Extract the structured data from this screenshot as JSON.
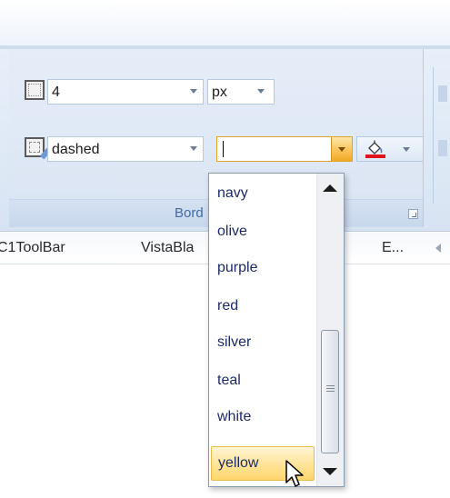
{
  "toolbar": {
    "border_width_value": "4",
    "border_unit_value": "px",
    "border_style_value": "dashed",
    "border_color_value": "",
    "group_caption": "Bord",
    "accent_color": "#f2a726",
    "fill_color_bar": "#e0141c"
  },
  "tabs": [
    "C1ToolBar",
    "VistaBla",
    "E..."
  ],
  "color_list": {
    "items": [
      "navy",
      "olive",
      "purple",
      "red",
      "silver",
      "teal",
      "white",
      "yellow"
    ],
    "highlighted": "yellow"
  },
  "icons": [
    "border-width-icon",
    "border-style-icon",
    "fill-color-icon",
    "dialog-launcher-icon",
    "mouse-cursor-icon"
  ]
}
